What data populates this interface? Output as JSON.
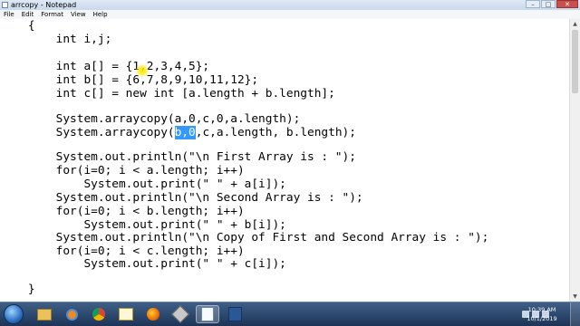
{
  "window": {
    "title": "arrcopy - Notepad",
    "controls": [
      "–",
      "□",
      "✕"
    ]
  },
  "menu": [
    "File",
    "Edit",
    "Format",
    "View",
    "Help"
  ],
  "editor": {
    "lines": [
      {
        "text": "    {"
      },
      {
        "text": ""
      },
      {
        "text": "        int i,j;"
      },
      {
        "text": ""
      },
      {
        "text": "        int a[] = {1,2,3,4,5};"
      },
      {
        "text": "        int b[] = {6,7,8,9,10,11,12};"
      },
      {
        "text": "        int c[] = new int [a.length + b.length];"
      },
      {
        "text": ""
      },
      {
        "text": "        System.arraycopy(a,0,c,0,a.length);"
      },
      {
        "before": "        System.arraycopy(",
        "selected": "b,0",
        "after": ",c,a.length, b.length);"
      },
      {
        "text": ""
      },
      {
        "text": "        System.out.println(\"\\n First Array is : \");"
      },
      {
        "text": "        for(i=0; i < a.length; i++)"
      },
      {
        "text": "            System.out.print(\" \" + a[i]);"
      },
      {
        "text": "        System.out.println(\"\\n Second Array is : \");"
      },
      {
        "text": "        for(i=0; i < b.length; i++)"
      },
      {
        "text": "            System.out.print(\" \" + b[i]);"
      },
      {
        "text": "        System.out.println(\"\\n Copy of First and Second Array is : \");"
      },
      {
        "text": "        for(i=0; i < c.length; i++)"
      },
      {
        "text": "            System.out.print(\" \" + c[i]);"
      },
      {
        "text": ""
      },
      {
        "text": "    }"
      }
    ]
  },
  "taskbar": {
    "apps": [
      "windows-explorer-icon",
      "media-player-icon",
      "chrome-icon",
      "paint-icon",
      "firefox-icon",
      "tool-icon",
      "notepad-icon",
      "word-icon"
    ],
    "time": "10:39 AM",
    "date": "10/1/2019"
  }
}
